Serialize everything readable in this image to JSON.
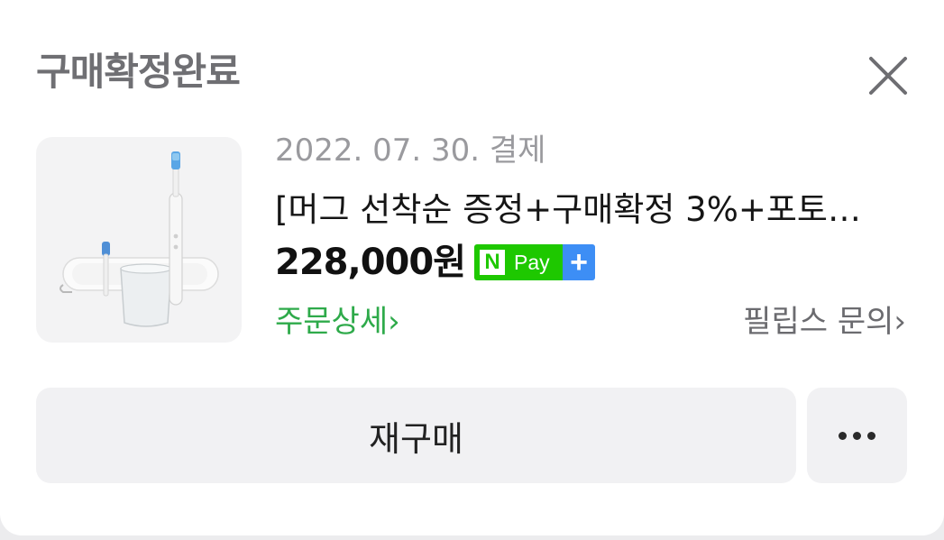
{
  "order": {
    "status": "구매확정완료",
    "date_paid": "2022. 07. 30. 결제",
    "product_name": "[머그 선착순 증정+구매확정 3%+포토…",
    "price": "228,000원",
    "order_detail_label": "주문상세",
    "seller_inquiry_label": "필립스 문의",
    "chevron": "›"
  },
  "npay": {
    "n_letter": "N",
    "pay_label": "Pay",
    "plus_label": "+",
    "colors": {
      "green": "#1ec800",
      "blue": "#3d8ef5"
    }
  },
  "actions": {
    "rebuy_label": "재구매",
    "more_icon": "more-horizontal-icon"
  },
  "icons": {
    "close": "close-icon"
  },
  "colors": {
    "accent_green": "#2eaa4a",
    "button_bg": "#f1f1f3"
  }
}
